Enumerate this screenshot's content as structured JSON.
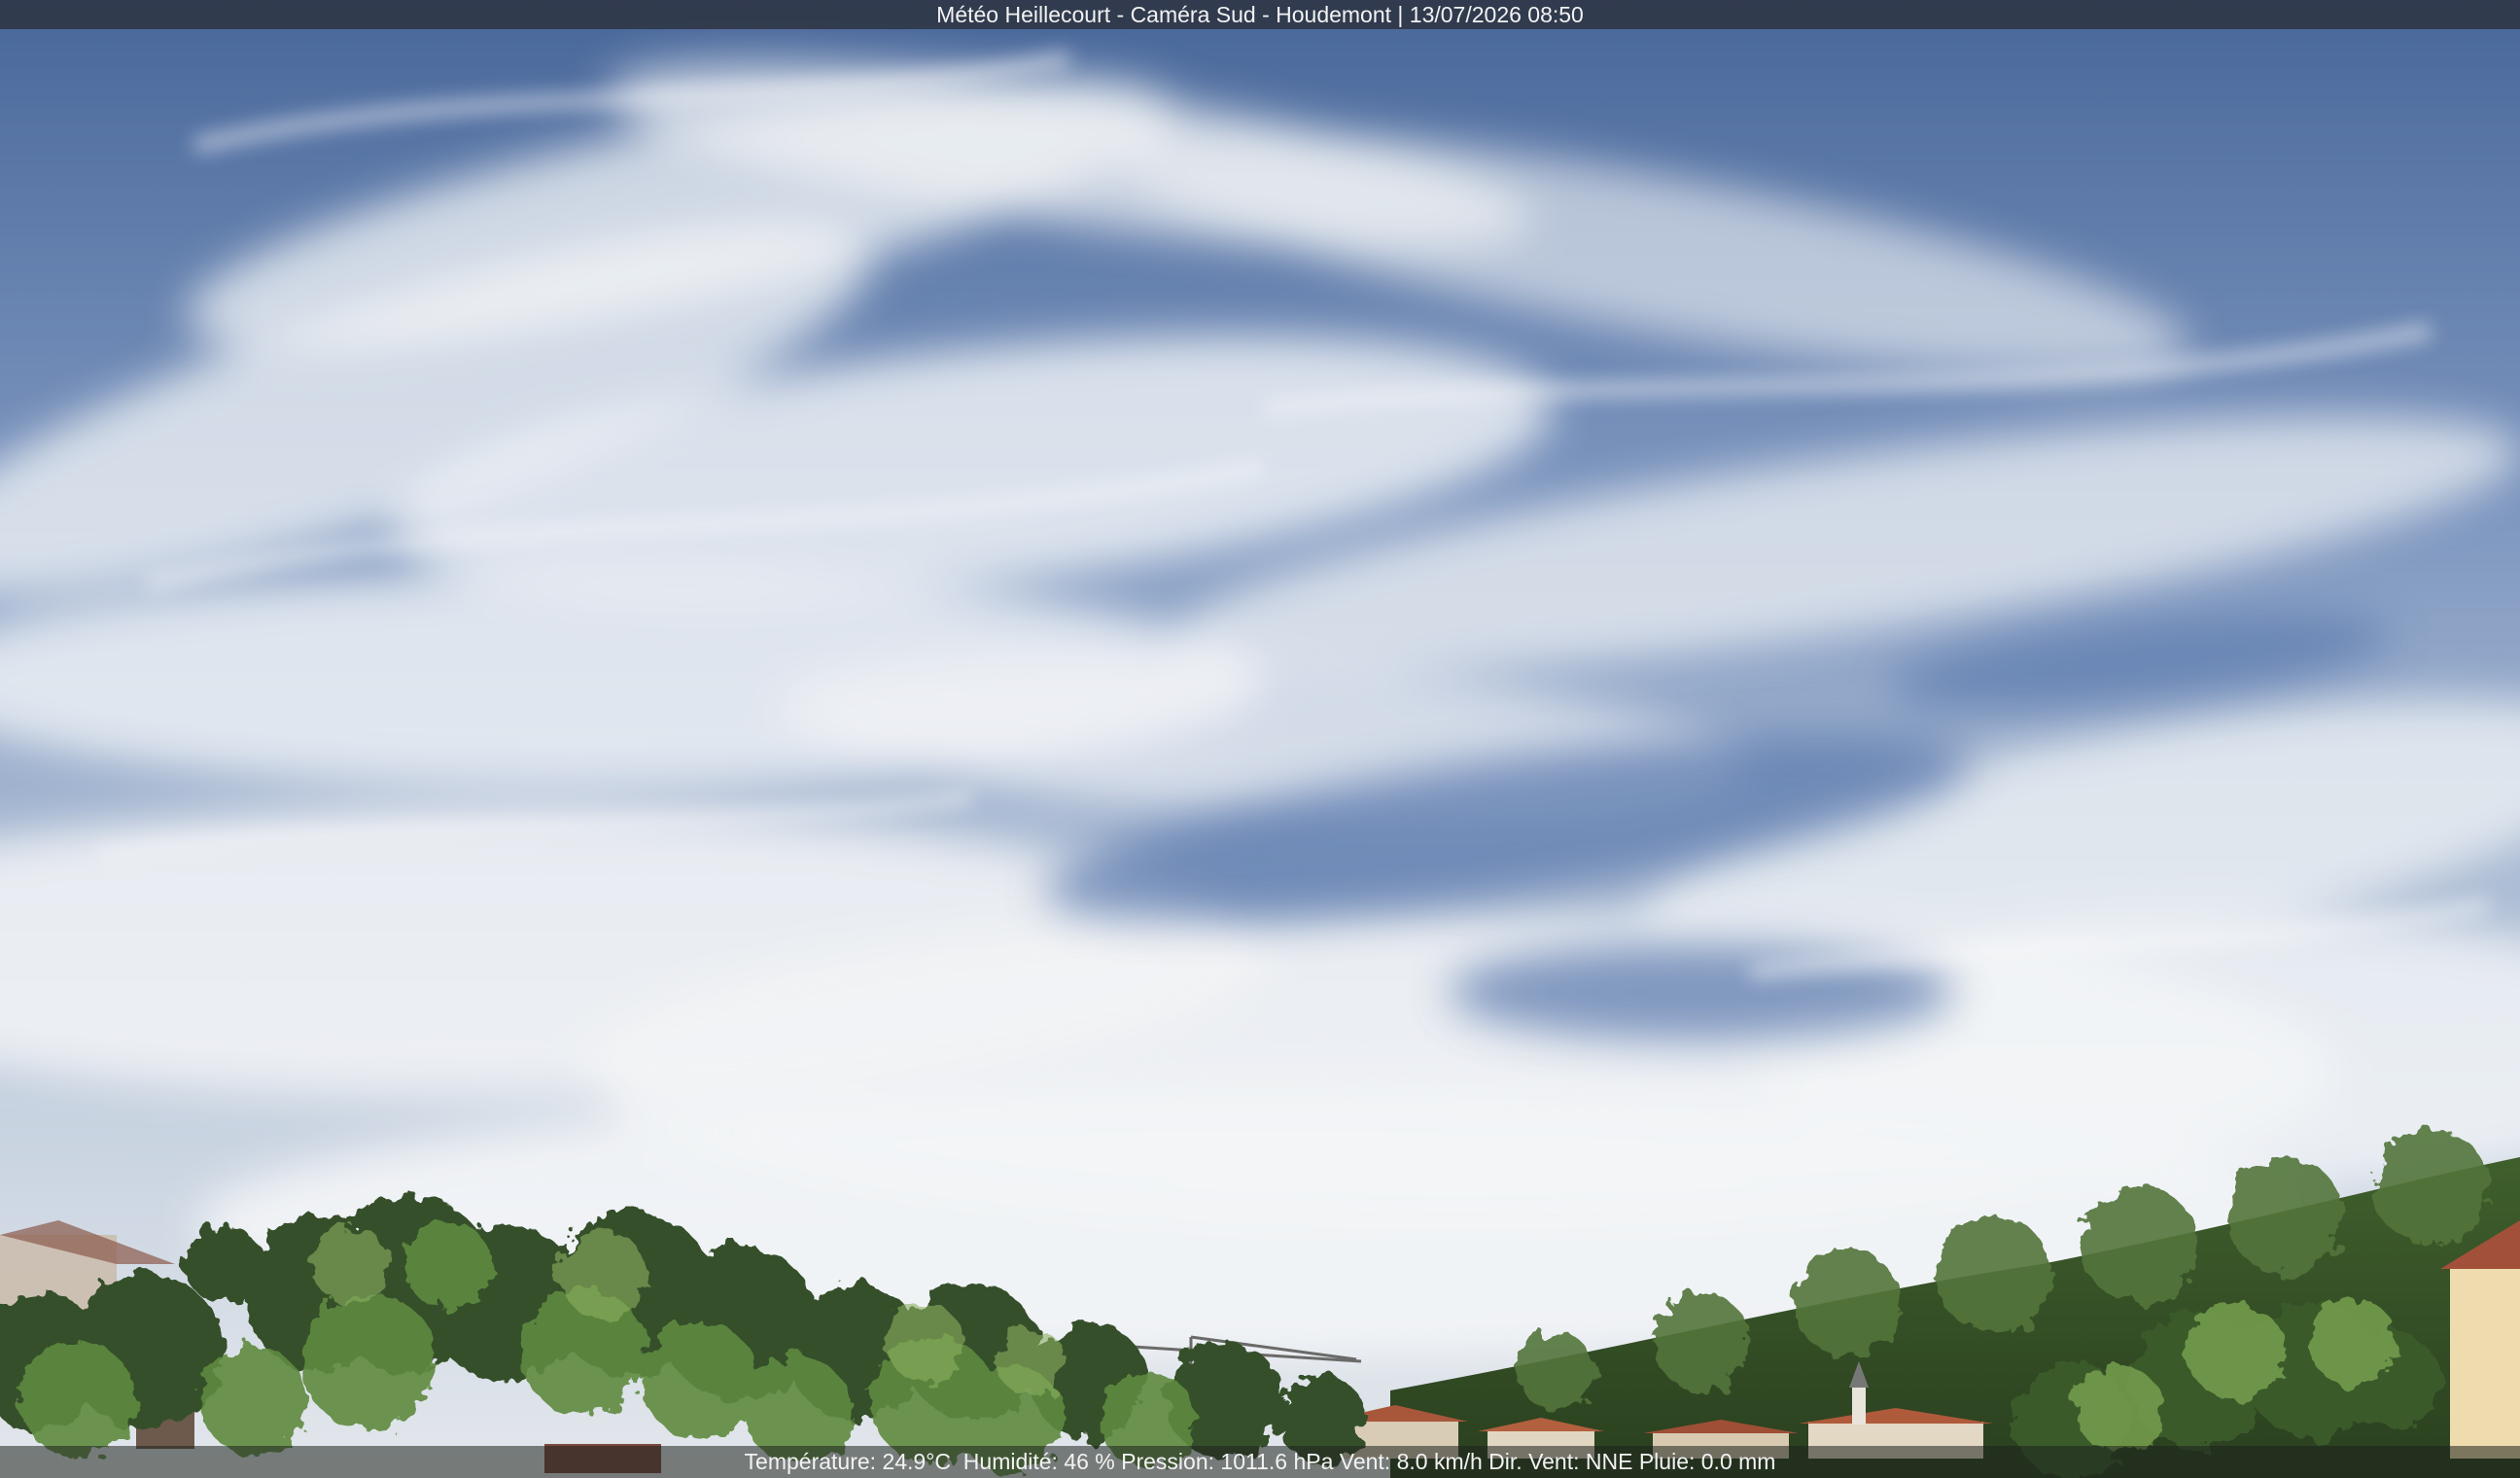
{
  "overlay": {
    "title": "Météo Heillecourt - Caméra Sud - Houdemont | 13/07/2026 08:50",
    "weather_line": "Température: 24.9°C  Humidité: 46 % Pression: 1011.6 hPa Vent: 8.0 km/h Dir. Vent: NNE Pluie: 0.0 mm"
  },
  "scene": {
    "description_tags": [
      "sky-icon",
      "cirrus-clouds-icon",
      "tree-icon",
      "house-icon",
      "crane-icon",
      "church-steeple-icon"
    ],
    "colors": {
      "sky_top": "#4f6f9f",
      "sky_mid": "#9fb1cc",
      "sky_horizon": "#dfe4ea",
      "cloud": "#f4f6f8",
      "foliage_dark": "#2f4a22",
      "foliage_light": "#6f9a4a",
      "roof": "#b05a3c"
    }
  }
}
